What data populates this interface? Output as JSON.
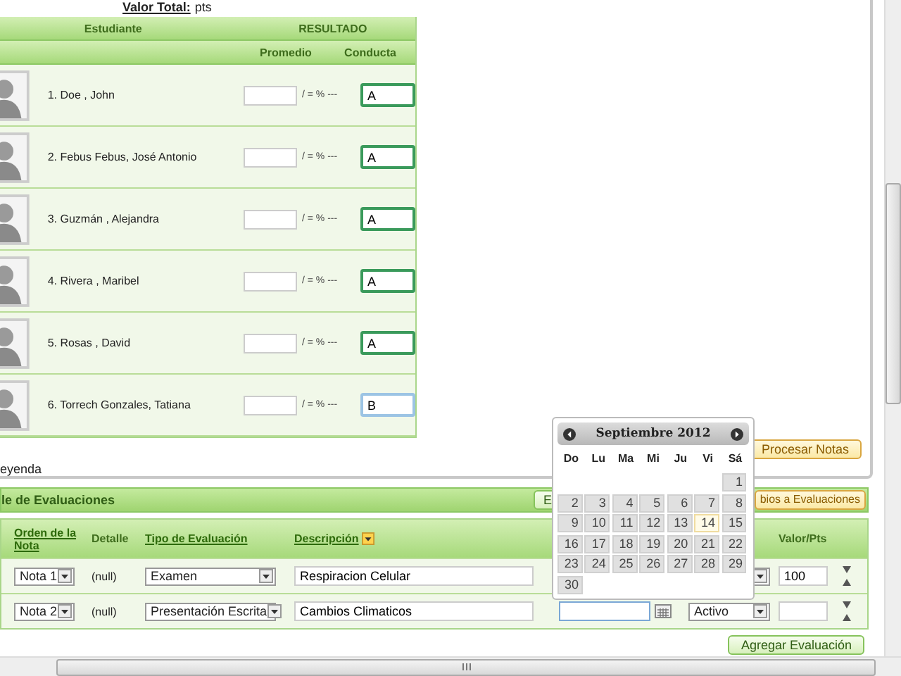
{
  "valor_total": {
    "label": "Valor Total:",
    "value": "pts"
  },
  "students_table": {
    "group_headers": [
      "Estudiante",
      "RESULTADO"
    ],
    "columns": [
      "Promedio",
      "Conducta"
    ],
    "rows": [
      {
        "name": "1. Doe , John",
        "promedio_suffix": "/ = % ---",
        "conducta": "A",
        "focused": false
      },
      {
        "name": "2. Febus Febus, José Antonio",
        "promedio_suffix": "/ = % ---",
        "conducta": "A",
        "focused": false
      },
      {
        "name": "3. Guzmán , Alejandra",
        "promedio_suffix": "/ = % ---",
        "conducta": "A",
        "focused": false
      },
      {
        "name": "4. Rivera , Maribel",
        "promedio_suffix": "/ = % ---",
        "conducta": "A",
        "focused": false
      },
      {
        "name": "5. Rosas , David",
        "promedio_suffix": "/ = % ---",
        "conducta": "A",
        "focused": false
      },
      {
        "name": "6. Torrech Gonzales, Tatiana",
        "promedio_suffix": "/ = % ---",
        "conducta": "B",
        "focused": true
      }
    ]
  },
  "procesar_button": "Procesar Notas",
  "leyenda": "eyenda",
  "evaluaciones": {
    "title": "le de Evaluaciones",
    "buttons": [
      "E",
      "bios a Evaluaciones"
    ],
    "columns": [
      {
        "label": "Orden de la Nota",
        "kind": "link"
      },
      {
        "label": "Detalle",
        "kind": "plain"
      },
      {
        "label": "Tipo de Evaluación",
        "kind": "link"
      },
      {
        "label": "Descripción",
        "kind": "sortlink"
      },
      {
        "label": "Valor/Pts",
        "kind": "plain"
      }
    ],
    "rows": [
      {
        "orden": "Nota 1",
        "detalle": "(null)",
        "tipo": "Examen",
        "descripcion": "Respiracion Celular",
        "valor": "100"
      },
      {
        "orden": "Nota 2",
        "detalle": "(null)",
        "tipo": "Presentación Escrita",
        "descripcion": "Cambios Climaticos",
        "fecha_focused": true,
        "estado": "Activo"
      }
    ],
    "add_button": "Agregar Evaluación"
  },
  "calendar": {
    "title": "Septiembre 2012",
    "weekdays": [
      "Do",
      "Lu",
      "Ma",
      "Mi",
      "Ju",
      "Vi",
      "Sá"
    ],
    "weeks": [
      [
        {
          "kind": "blank"
        },
        {
          "kind": "blank"
        },
        {
          "kind": "blank"
        },
        {
          "kind": "blank"
        },
        {
          "kind": "blank"
        },
        {
          "kind": "blank"
        },
        {
          "kind": "day",
          "day": "1",
          "today": false
        }
      ],
      [
        {
          "kind": "day",
          "day": "2",
          "today": false
        },
        {
          "kind": "day",
          "day": "3",
          "today": false
        },
        {
          "kind": "day",
          "day": "4",
          "today": false
        },
        {
          "kind": "day",
          "day": "5",
          "today": false
        },
        {
          "kind": "day",
          "day": "6",
          "today": false
        },
        {
          "kind": "day",
          "day": "7",
          "today": false
        },
        {
          "kind": "day",
          "day": "8",
          "today": false
        }
      ],
      [
        {
          "kind": "day",
          "day": "9",
          "today": false
        },
        {
          "kind": "day",
          "day": "10",
          "today": false
        },
        {
          "kind": "day",
          "day": "11",
          "today": false
        },
        {
          "kind": "day",
          "day": "12",
          "today": false
        },
        {
          "kind": "day",
          "day": "13",
          "today": false
        },
        {
          "kind": "day",
          "day": "14",
          "today": true
        },
        {
          "kind": "day",
          "day": "15",
          "today": false
        }
      ],
      [
        {
          "kind": "day",
          "day": "16",
          "today": false
        },
        {
          "kind": "day",
          "day": "17",
          "today": false
        },
        {
          "kind": "day",
          "day": "18",
          "today": false
        },
        {
          "kind": "day",
          "day": "19",
          "today": false
        },
        {
          "kind": "day",
          "day": "20",
          "today": false
        },
        {
          "kind": "day",
          "day": "21",
          "today": false
        },
        {
          "kind": "day",
          "day": "22",
          "today": false
        }
      ],
      [
        {
          "kind": "day",
          "day": "23",
          "today": false
        },
        {
          "kind": "day",
          "day": "24",
          "today": false
        },
        {
          "kind": "day",
          "day": "25",
          "today": false
        },
        {
          "kind": "day",
          "day": "26",
          "today": false
        },
        {
          "kind": "day",
          "day": "27",
          "today": false
        },
        {
          "kind": "day",
          "day": "28",
          "today": false
        },
        {
          "kind": "day",
          "day": "29",
          "today": false
        }
      ],
      [
        {
          "kind": "day",
          "day": "30",
          "today": false
        }
      ]
    ]
  }
}
